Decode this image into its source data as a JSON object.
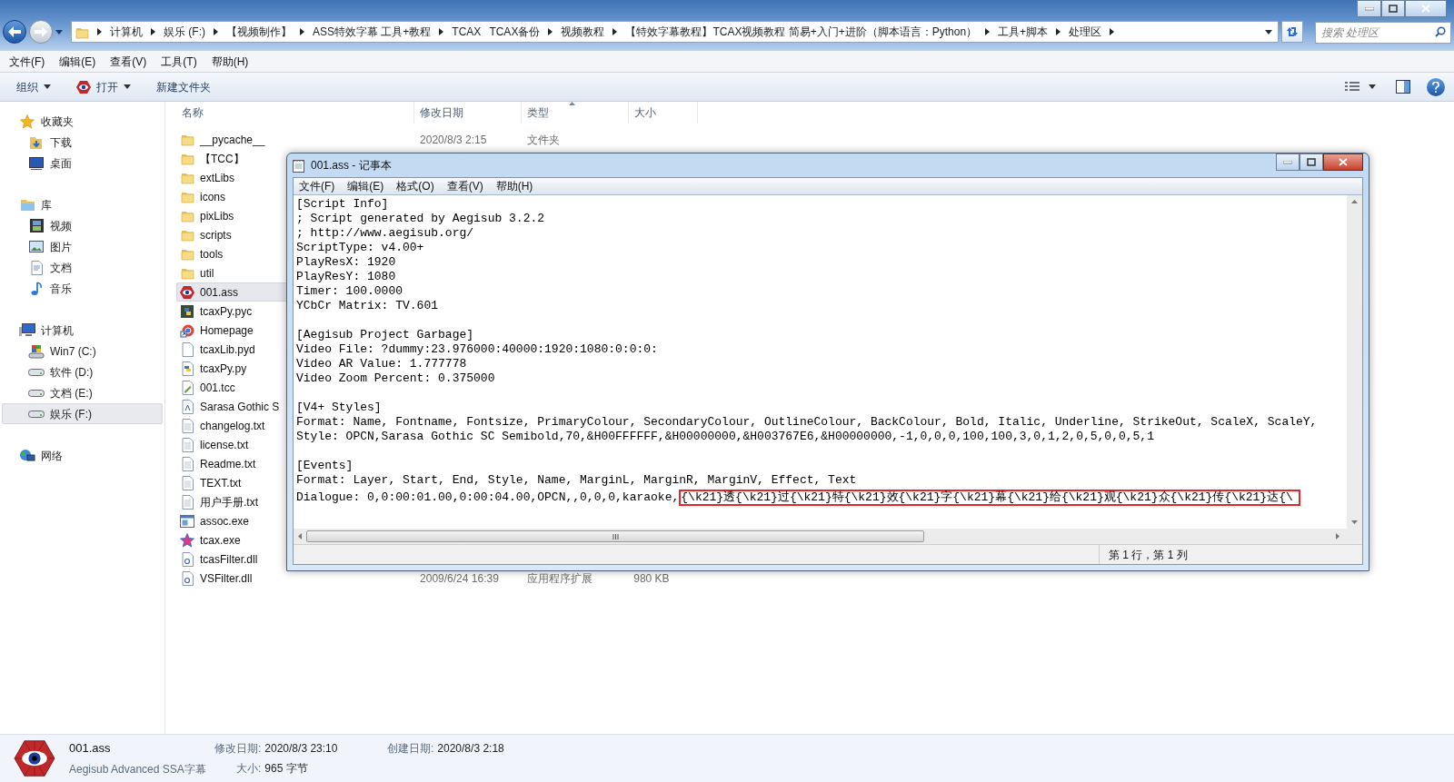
{
  "explorer": {
    "breadcrumbs": [
      {
        "label": "计算机",
        "arrow_after": true
      },
      {
        "label": "娱乐 (F:)",
        "arrow_after": true
      },
      {
        "label": "【视频制作】",
        "arrow_after": true
      },
      {
        "label": "ASS特效字幕 工具+教程",
        "arrow_after": true
      },
      {
        "label": "TCAX",
        "arrow_after": false
      },
      {
        "label": "TCAX备份",
        "arrow_after": true
      },
      {
        "label": "视频教程",
        "arrow_after": true
      },
      {
        "label": "【特效字幕教程】TCAX视频教程 简易+入门+进阶（脚本语言：Python）",
        "arrow_after": true
      },
      {
        "label": "工具+脚本",
        "arrow_after": true
      },
      {
        "label": "处理区",
        "arrow_after": true
      }
    ],
    "search": {
      "placeholder": "搜索 处理区"
    },
    "menu": [
      "文件(F)",
      "编辑(E)",
      "查看(V)",
      "工具(T)",
      "帮助(H)"
    ],
    "toolbar": [
      {
        "label": "组织",
        "kind": "dropdown"
      },
      {
        "label": "打开",
        "kind": "open"
      },
      {
        "label": "新建文件夹",
        "kind": "plain"
      }
    ],
    "nav": [
      {
        "label": "收藏夹",
        "kind": "star",
        "selected": false,
        "children": [
          {
            "label": "下载",
            "kind": "download",
            "selected": false
          },
          {
            "label": "桌面",
            "kind": "desktop",
            "selected": false
          }
        ]
      },
      {
        "label": "库",
        "kind": "library",
        "selected": false,
        "children": [
          {
            "label": "视频",
            "kind": "video",
            "selected": false
          },
          {
            "label": "图片",
            "kind": "image",
            "selected": false
          },
          {
            "label": "文档",
            "kind": "document",
            "selected": false
          },
          {
            "label": "音乐",
            "kind": "music",
            "selected": false
          }
        ]
      },
      {
        "label": "计算机",
        "kind": "computer",
        "selected": false,
        "children": [
          {
            "label": "Win7 (C:)",
            "kind": "system",
            "selected": false
          },
          {
            "label": "软件 (D:)",
            "kind": "drive",
            "selected": false
          },
          {
            "label": "文档 (E:)",
            "kind": "drive",
            "selected": false
          },
          {
            "label": "娱乐 (F:)",
            "kind": "drive",
            "selected": true
          }
        ]
      },
      {
        "label": "网络",
        "kind": "network",
        "selected": false
      }
    ],
    "columns": [
      {
        "label": "名称",
        "sorted": false
      },
      {
        "label": "修改日期",
        "sorted": false
      },
      {
        "label": "类型",
        "sorted": true
      },
      {
        "label": "大小",
        "sorted": false
      }
    ],
    "files": [
      {
        "name": "__pycache__",
        "kind": "folder",
        "selected": false,
        "date": "2020/8/3 2:15",
        "type": "文件夹"
      },
      {
        "name": "【TCC】",
        "kind": "folder",
        "selected": false
      },
      {
        "name": "extLibs",
        "kind": "folder",
        "selected": false
      },
      {
        "name": "icons",
        "kind": "folder",
        "selected": false
      },
      {
        "name": "pixLibs",
        "kind": "folder",
        "selected": false
      },
      {
        "name": "scripts",
        "kind": "folder",
        "selected": false
      },
      {
        "name": "tools",
        "kind": "folder",
        "selected": false
      },
      {
        "name": "util",
        "kind": "folder",
        "selected": false
      },
      {
        "name": "001.ass",
        "kind": "subtitle",
        "selected": true
      },
      {
        "name": "tcaxPy.pyc",
        "kind": "compiled",
        "selected": false
      },
      {
        "name": "Homepage",
        "kind": "shortcut",
        "selected": false
      },
      {
        "name": "tcaxLib.pyd",
        "kind": "blank",
        "selected": false
      },
      {
        "name": "tcaxPy.py",
        "kind": "script",
        "selected": false
      },
      {
        "name": "001.tcc",
        "kind": "config",
        "selected": false
      },
      {
        "name": "Sarasa Gothic S",
        "kind": "font",
        "selected": false
      },
      {
        "name": "changelog.txt",
        "kind": "text",
        "selected": false
      },
      {
        "name": "license.txt",
        "kind": "text",
        "selected": false
      },
      {
        "name": "Readme.txt",
        "kind": "text",
        "selected": false
      },
      {
        "name": "TEXT.txt",
        "kind": "text",
        "selected": false
      },
      {
        "name": "用户手册.txt",
        "kind": "text",
        "selected": false
      },
      {
        "name": "assoc.exe",
        "kind": "app",
        "selected": false
      },
      {
        "name": "tcax.exe",
        "kind": "starapp",
        "selected": false
      },
      {
        "name": "tcasFilter.dll",
        "kind": "library",
        "selected": false
      },
      {
        "name": "VSFilter.dll",
        "kind": "library",
        "selected": false,
        "date": "2009/6/24 16:39",
        "type": "应用程序扩展",
        "size": "980 KB"
      }
    ],
    "details": {
      "name": "001.ass",
      "file_type": "Aegisub Advanced SSA字幕",
      "modified_label": "修改日期:",
      "modified": "2020/8/3 23:10",
      "size_label": "大小:",
      "size": "965 字节",
      "created_label": "创建日期:",
      "created": "2020/8/3 2:18"
    }
  },
  "notepad": {
    "title": "001.ass - 记事本",
    "menu": [
      "文件(F)",
      "编辑(E)",
      "格式(O)",
      "查看(V)",
      "帮助(H)"
    ],
    "sections": [
      {
        "lines": [
          {
            "text": "[Script Info]"
          },
          {
            "text": "; Script generated by Aegisub 3.2.2"
          },
          {
            "text": "; http://www.aegisub.org/"
          },
          {
            "text": "ScriptType: v4.00+"
          },
          {
            "text": "PlayResX: 1920"
          },
          {
            "text": "PlayResY: 1080"
          },
          {
            "text": "Timer: 100.0000"
          },
          {
            "text": "YCbCr Matrix: TV.601"
          }
        ]
      },
      {
        "lines": [
          {
            "text": "[Aegisub Project Garbage]"
          },
          {
            "text": "Video File: ?dummy:23.976000:40000:1920:1080:0:0:0:"
          },
          {
            "text": "Video AR Value: 1.777778"
          },
          {
            "text": "Video Zoom Percent: 0.375000"
          }
        ]
      },
      {
        "lines": [
          {
            "text": "[V4+ Styles]"
          },
          {
            "text": "Format: Name, Fontname, Fontsize, PrimaryColour, SecondaryColour, OutlineColour, BackColour, Bold, Italic, Underline, StrikeOut, ScaleX, ScaleY,"
          },
          {
            "text": "Style: OPCN,Sarasa Gothic SC Semibold,70,&H00FFFFFF,&H00000000,&H003767E6,&H00000000,-1,0,0,0,100,100,3,0,1,2,0,5,0,0,5,1"
          }
        ]
      },
      {
        "lines": [
          {
            "text": "[Events]"
          },
          {
            "text": "Format: Layer, Start, End, Style, Name, MarginL, MarginR, MarginV, Effect, Text"
          },
          {
            "text": "Dialogue: 0,0:00:01.00,0:00:04.00,OPCN,,0,0,0,karaoke,",
            "highlighted": "{\\k21}透{\\k21}过{\\k21}特{\\k21}效{\\k21}字{\\k21}幕{\\k21}给{\\k21}观{\\k21}众{\\k21}传{\\k21}达{\\"
          }
        ]
      }
    ],
    "status": "第 1 行，第 1 列"
  }
}
